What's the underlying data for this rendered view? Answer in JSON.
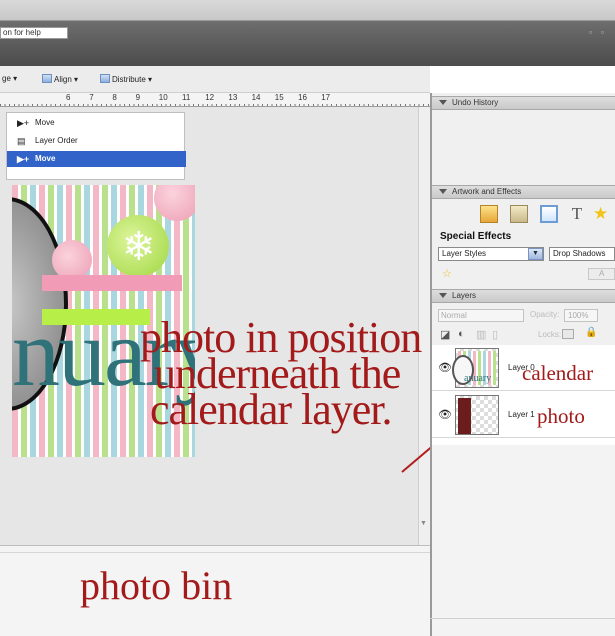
{
  "titlebar": {
    "help_text": "on for help",
    "window_controls": "▫ ▫"
  },
  "toolbar": {
    "arrange_fragment": "ge ▾",
    "align_label": "Align ▾",
    "distribute_label": "Distribute ▾"
  },
  "ruler": {
    "labels": [
      "6",
      "7",
      "8",
      "9",
      "10",
      "11",
      "12",
      "13",
      "14",
      "15",
      "16",
      "17"
    ]
  },
  "annotations": {
    "line1": "photo in position",
    "line2": "underneath the",
    "line3": "calendar layer.",
    "photo_bin": "photo bin",
    "calendar_label": "calendar",
    "photo_label": "photo"
  },
  "undo_history": {
    "title": "Undo History",
    "items": [
      {
        "label": "Move",
        "icon": "move-arrow-icon",
        "selected": false
      },
      {
        "label": "Layer Order",
        "icon": "layer-order-icon",
        "selected": false
      },
      {
        "label": "Move",
        "icon": "move-arrow-icon",
        "selected": true
      }
    ]
  },
  "artwork": {
    "title": "Artwork and Effects",
    "type_glyph": "T",
    "special_effects_title": "Special Effects",
    "category_select": "Layer Styles",
    "style_select": "Drop Shadows",
    "apply_fragment": "A"
  },
  "layers": {
    "title": "Layers",
    "blend_mode": "Normal",
    "opacity_label": "Opacity:",
    "opacity_value": "100%",
    "locks_label": "Locks:",
    "rows": [
      {
        "name": "Layer 0",
        "thumb_word": "anuary"
      },
      {
        "name": "Layer 1"
      }
    ]
  },
  "document": {
    "word": "nuary"
  },
  "colors": {
    "annotation": "#a31a1a",
    "selection": "#3163c9",
    "teal_text": "#2f7279"
  }
}
